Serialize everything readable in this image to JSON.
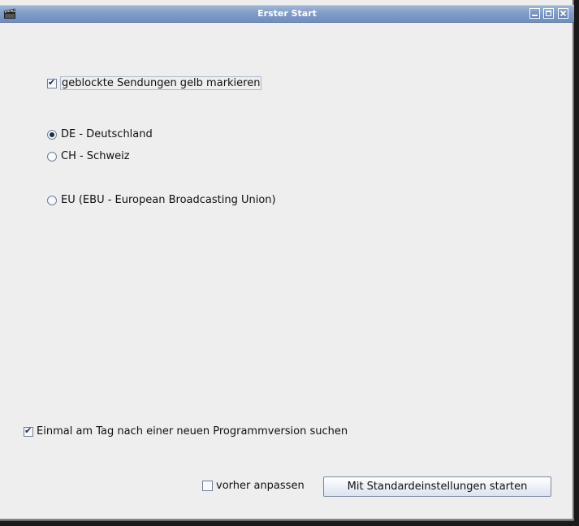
{
  "window": {
    "title": "Erster Start",
    "icon": "clapperboard-icon"
  },
  "options": {
    "blocked_highlight": {
      "label": "geblockte Sendungen gelb markieren",
      "checked": true
    }
  },
  "region": {
    "items": [
      {
        "label": "DE - Deutschland",
        "selected": true
      },
      {
        "label": "CH - Schweiz",
        "selected": false
      },
      {
        "label": "EU (EBU - European Broadcasting Union)",
        "selected": false
      }
    ]
  },
  "update_check": {
    "label": "Einmal am Tag nach einer neuen Programmversion suchen",
    "checked": true
  },
  "customize": {
    "label": "vorher anpassen",
    "checked": false
  },
  "start_button": {
    "label": "Mit Standardeinstellungen starten"
  },
  "colors": {
    "titlebar": "#7d9bc7",
    "background": "#eeeeee"
  }
}
